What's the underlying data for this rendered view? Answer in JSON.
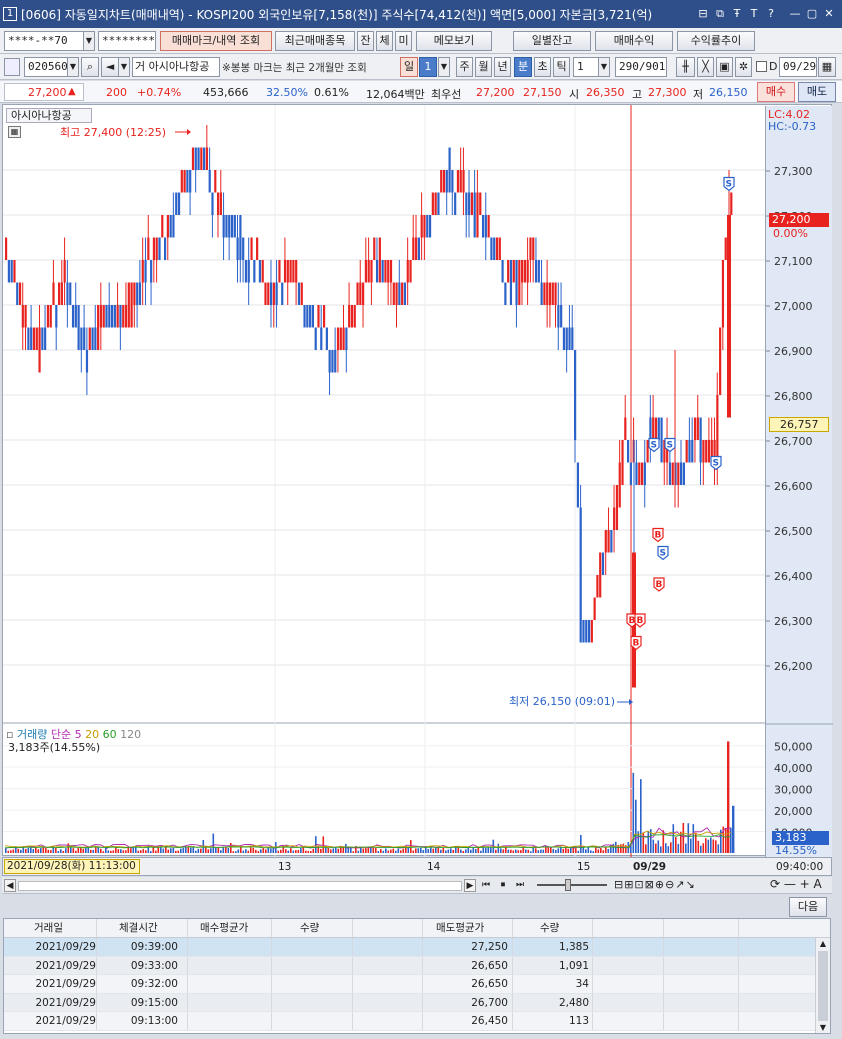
{
  "titlebar": {
    "number": "1",
    "title": "[0606] 자동일지차트(매매내역) - KOSPI200 외국인보유[7,158(천)] 주식수[74,412(천)] 액면[5,000] 자본금[3,721(억)",
    "buttons": [
      "⊟",
      "⧉",
      "Ŧ",
      "T",
      "?",
      "—",
      "▢",
      "✕"
    ]
  },
  "toolbar1": {
    "account": "****-**70",
    "password": "********",
    "trade_mark_btn": "매매마크/내역 조회",
    "recent_trade_btn": "최근매매종목",
    "jan_btn": "잔",
    "che_btn": "체",
    "mi_btn": "미",
    "memo_btn": "메모보기",
    "daily_balance_btn": "일별잔고",
    "trade_profit_btn": "매매수익",
    "profit_trend_btn": "수익률추이"
  },
  "toolbar2": {
    "code": "020560",
    "market_tag": "거",
    "stock_name": "아시아나항공",
    "note": "※봉봉 마크는 최근 2개월만 조회",
    "period_il": "일",
    "period_value": "1",
    "period_ju": "주",
    "period_wol": "월",
    "period_nyeon": "년",
    "period_bun": "분",
    "period_cho": "초",
    "period_tik": "틱",
    "interval_value": "1",
    "count": "290/901",
    "date": "09/29",
    "checkbox_label": "D"
  },
  "quote": {
    "price": "27,200",
    "price_arrow": "▲",
    "change": "200",
    "change_pct": "+0.74%",
    "volume": "453,666",
    "vol_ratio": "32.50%",
    "turnover": "0.61%",
    "amount": "12,064백만",
    "best_label": "최우선",
    "best_ask": "27,200",
    "best_bid": "27,150",
    "open_label": "시",
    "open": "26,350",
    "high_label": "고",
    "high": "27,300",
    "low_label": "저",
    "low": "26,150",
    "buy_btn": "매수",
    "sell_btn": "매도"
  },
  "chart_header": {
    "stock_name": "아시아나항공",
    "high_annotation": "최고 27,400 (12:25)",
    "low_annotation": "최저 26,150 (09:01)",
    "lc": "LC:4.02",
    "hc": "HC:-0.73",
    "current_price_tag": "27,200",
    "current_pct_tag": "0.00%",
    "cursor_price_tag": "26,757"
  },
  "volume_header": {
    "title": "거래량",
    "ma_label": "단순",
    "ma1": "5",
    "ma2": "20",
    "ma3": "60",
    "ma4": "120",
    "current": "3,183주(14.55%)",
    "last_volume_tag": "3,183",
    "last_pct_tag": "14.55%"
  },
  "x_axis": {
    "cursor_label": "2021/09/28(화) 11:13:00",
    "ticks": [
      "13",
      "14",
      "15",
      "09/29"
    ],
    "time_label": "09:40:00"
  },
  "chart_data": {
    "type": "candlestick",
    "y_ticks": [
      27300,
      27200,
      27100,
      27000,
      26900,
      26800,
      26700,
      26600,
      26500,
      26400,
      26300,
      26200
    ],
    "y_tick_labels": [
      "27,300",
      "27,200",
      "27,100",
      "27,000",
      "26,900",
      "26,800",
      "26,700",
      "26,600",
      "26,500",
      "26,400",
      "26,300",
      "26,200"
    ],
    "ylim": [
      26100,
      27400
    ],
    "volume_ticks": [
      "50,000",
      "40,000",
      "30,000",
      "20,000",
      "10,000"
    ],
    "volume_ylim": [
      0,
      55000
    ],
    "price_path": [
      27100,
      27050,
      27000,
      26950,
      26900,
      26950,
      27000,
      27050,
      27000,
      26950,
      26900,
      26950,
      27000,
      27000,
      26950,
      27000,
      27050,
      27100,
      27100,
      27150,
      27200,
      27250,
      27300,
      27350,
      27300,
      27250,
      27200,
      27200,
      27150,
      27100,
      27100,
      27050,
      27000,
      27050,
      27100,
      27050,
      27000,
      26950,
      26950,
      26900,
      26900,
      26950,
      27000,
      27050,
      27100,
      27100,
      27050,
      27000,
      27050,
      27100,
      27150,
      27200,
      27250,
      27300,
      27250,
      27250,
      27200,
      27200,
      27150,
      27100,
      27050,
      27050,
      27050,
      27100,
      27050,
      27000,
      27000,
      26950,
      26900,
      26300,
      26250,
      26400,
      26450,
      26500,
      26700,
      26650,
      26600,
      26700,
      26750,
      26650,
      26600,
      26650,
      26700,
      26700,
      26650,
      26650,
      27100,
      27200
    ],
    "trade_marks": [
      {
        "type": "B",
        "price": 26300
      },
      {
        "type": "B",
        "price": 26300
      },
      {
        "type": "B",
        "price": 26250
      },
      {
        "type": "B",
        "price": 26490
      },
      {
        "type": "S",
        "price": 26450
      },
      {
        "type": "B",
        "price": 26380
      },
      {
        "type": "S",
        "price": 26690
      },
      {
        "type": "S",
        "price": 26690
      },
      {
        "type": "S",
        "price": 26650
      },
      {
        "type": "S",
        "price": 27270
      }
    ]
  },
  "scroll_toolbar": {
    "next_btn": "다음",
    "icons": [
      "◀",
      "▶",
      "⏮",
      "⏹",
      "⏭",
      "⊟",
      "⊞",
      "⊡",
      "⊠",
      "⊕",
      "⊖",
      "↗",
      "↘",
      "A"
    ]
  },
  "table": {
    "headers": [
      "거래일",
      "체결시간",
      "매수평균가",
      "수량",
      "",
      "매도평균가",
      "수량",
      "",
      ""
    ],
    "rows": [
      {
        "date": "2021/09/29",
        "time": "09:39:00",
        "buy_avg": "",
        "buy_qty": "",
        "sell_avg": "27,250",
        "sell_qty": "1,385"
      },
      {
        "date": "2021/09/29",
        "time": "09:33:00",
        "buy_avg": "",
        "buy_qty": "",
        "sell_avg": "26,650",
        "sell_qty": "1,091"
      },
      {
        "date": "2021/09/29",
        "time": "09:32:00",
        "buy_avg": "",
        "buy_qty": "",
        "sell_avg": "26,650",
        "sell_qty": "34"
      },
      {
        "date": "2021/09/29",
        "time": "09:15:00",
        "buy_avg": "",
        "buy_qty": "",
        "sell_avg": "26,700",
        "sell_qty": "2,480"
      },
      {
        "date": "2021/09/29",
        "time": "09:13:00",
        "buy_avg": "",
        "buy_qty": "",
        "sell_avg": "26,450",
        "sell_qty": "113"
      }
    ]
  },
  "colors": {
    "up": "#e8231f",
    "down": "#2a62c9",
    "titlebar": "#2f4f8a"
  }
}
